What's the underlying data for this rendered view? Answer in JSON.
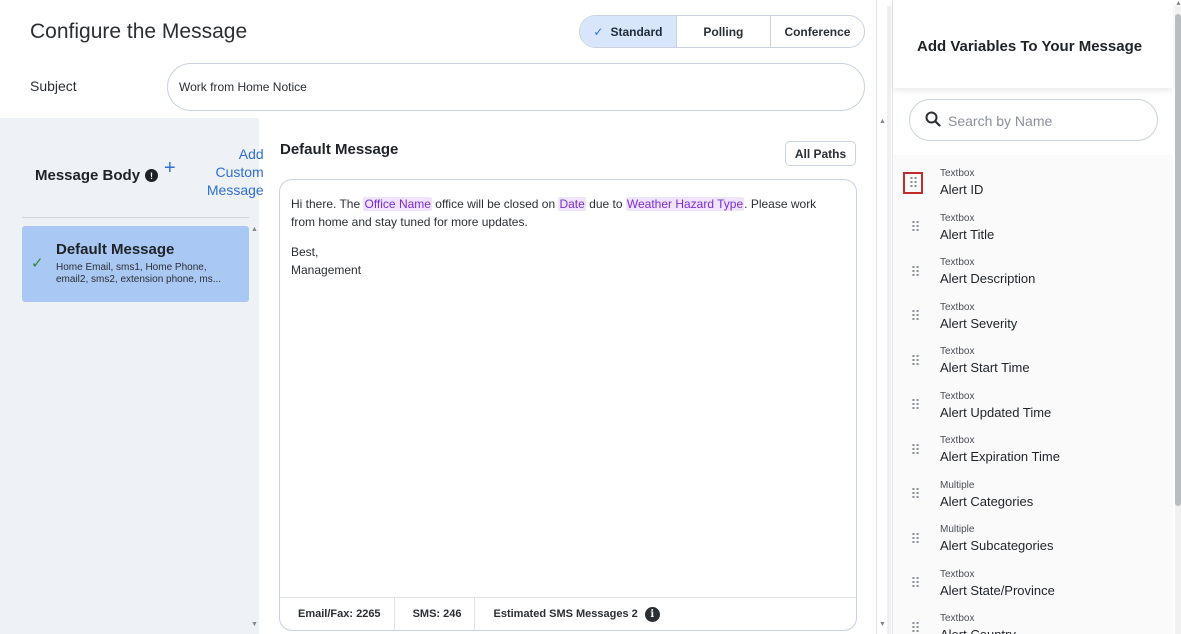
{
  "header": {
    "title": "Configure the Message",
    "message_types": [
      {
        "label": "Standard",
        "active": true
      },
      {
        "label": "Polling",
        "active": false
      },
      {
        "label": "Conference",
        "active": false
      }
    ]
  },
  "subject": {
    "label": "Subject",
    "value": "Work from Home Notice"
  },
  "message_body": {
    "title": "Message Body",
    "info_icon": "info-icon",
    "add_custom_label": "Add\nCustom\nMessage",
    "messages": [
      {
        "name": "Default Message",
        "paths": "Home Email, sms1, Home Phone, email2, sms2, extension phone, ms...",
        "selected": true
      }
    ]
  },
  "editor": {
    "title": "Default Message",
    "all_paths_label": "All Paths",
    "line1_parts": [
      "Hi there. The ",
      "Office Name",
      " office will be closed on ",
      "Date",
      " due to ",
      "Weather Hazard Type",
      ". Please work from home and stay tuned for more updates."
    ],
    "line2": "Best,",
    "line3": "Management",
    "footer": {
      "email_fax": "Email/Fax: 2265",
      "sms": "SMS: 246",
      "estimated": "Estimated SMS Messages 2"
    }
  },
  "variables_panel": {
    "title": "Add Variables To Your Message",
    "search_placeholder": "Search by Name",
    "items": [
      {
        "type": "Textbox",
        "name": "Alert ID",
        "selected": true
      },
      {
        "type": "Textbox",
        "name": "Alert Title"
      },
      {
        "type": "Textbox",
        "name": "Alert Description"
      },
      {
        "type": "Textbox",
        "name": "Alert Severity"
      },
      {
        "type": "Textbox",
        "name": "Alert Start Time"
      },
      {
        "type": "Textbox",
        "name": "Alert Updated Time"
      },
      {
        "type": "Textbox",
        "name": "Alert Expiration Time"
      },
      {
        "type": "Multiple",
        "name": "Alert Categories"
      },
      {
        "type": "Multiple",
        "name": "Alert Subcategories"
      },
      {
        "type": "Textbox",
        "name": "Alert State/Province"
      },
      {
        "type": "Textbox",
        "name": "Alert Country"
      }
    ]
  },
  "colors": {
    "accent": "#2f6fd6",
    "active_segment": "#d7e6fb",
    "selected_card": "#a9c8f3",
    "variable_text": "#7a2fd0",
    "variable_bg": "#efe4fb",
    "highlight_border": "#c22c2c"
  }
}
